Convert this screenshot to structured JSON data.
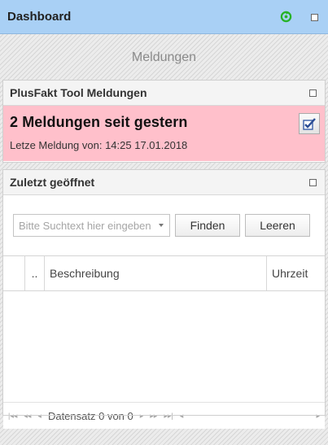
{
  "dashboard": {
    "title": "Dashboard",
    "subtitle": "Meldungen"
  },
  "plusfakt": {
    "title": "PlusFakt Tool Meldungen",
    "headline": "2 Meldungen seit gestern",
    "last_message": "Letze Meldung von: 14:25 17.01.2018"
  },
  "recent": {
    "title": "Zuletzt geöffnet",
    "search_placeholder": "Bitte Suchtext hier eingeben",
    "find_label": "Finden",
    "clear_label": "Leeren",
    "columns": [
      "..",
      "Beschreibung",
      "Uhrzeit"
    ],
    "rows": [],
    "pager_text": "Datensatz 0 von 0"
  },
  "colors": {
    "header_bg": "#a9d0f5",
    "alert_bg": "#ffc0cb",
    "refresh_icon": "#27b227"
  },
  "icons": {
    "refresh": "refresh-icon",
    "maximize": "maximize-icon",
    "checkmark": "checkbox-check-icon"
  }
}
